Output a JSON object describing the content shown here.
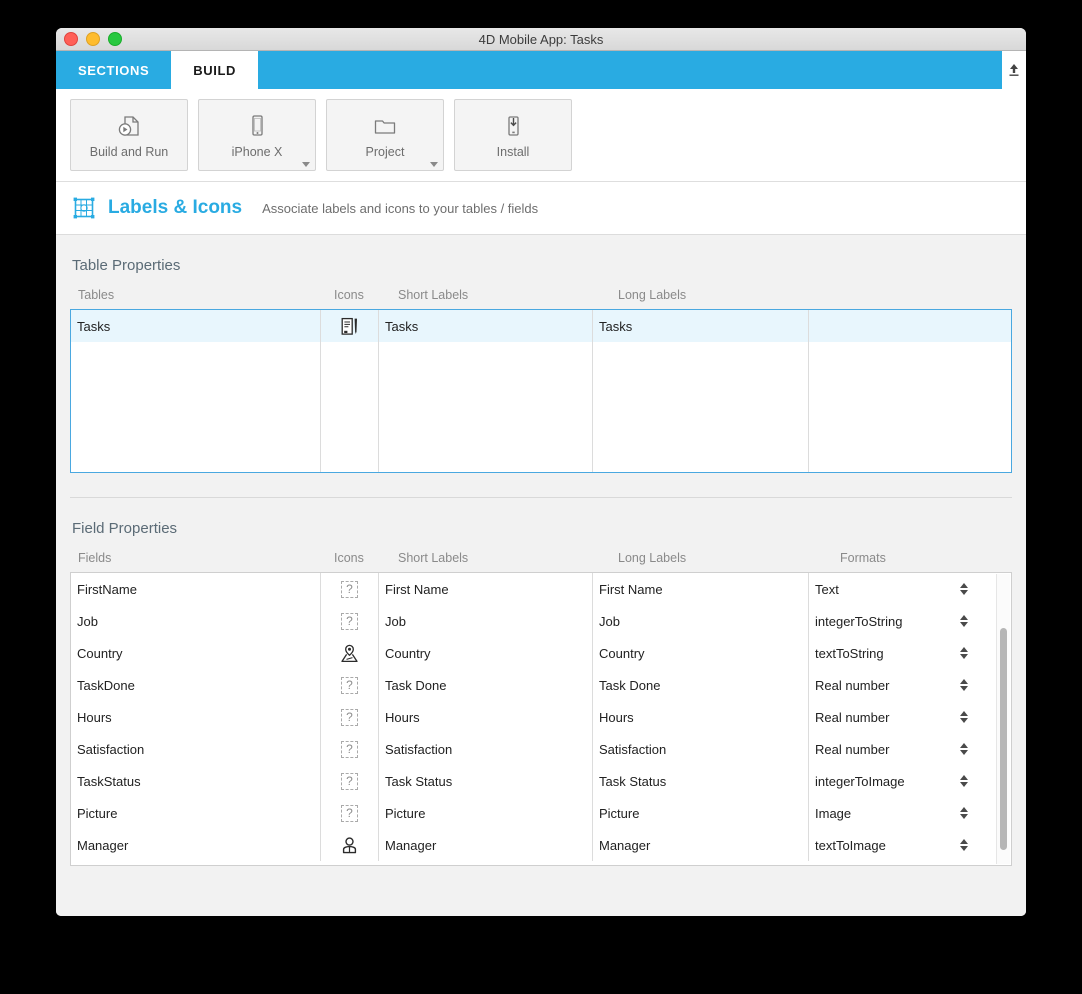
{
  "window": {
    "title": "4D Mobile App: Tasks",
    "controls": [
      "close",
      "minimize",
      "zoom"
    ]
  },
  "tabs": [
    {
      "label": "SECTIONS",
      "active": false
    },
    {
      "label": "BUILD",
      "active": true
    }
  ],
  "tabbar": {
    "upload_icon": "upload-icon"
  },
  "toolbar": {
    "buttons": [
      {
        "label": "Build and Run",
        "icon": "document-play-icon",
        "has_dropdown": false
      },
      {
        "label": "iPhone X",
        "icon": "phone-icon",
        "has_dropdown": true
      },
      {
        "label": "Project",
        "icon": "folder-icon",
        "has_dropdown": true
      },
      {
        "label": "Install",
        "icon": "device-install-icon",
        "has_dropdown": false
      }
    ]
  },
  "section": {
    "icon": "labels-grid-icon",
    "title": "Labels & Icons",
    "subtitle": "Associate labels and icons to your tables / fields",
    "accent_color": "#29abe2"
  },
  "table_properties": {
    "panel_title": "Table Properties",
    "columns": [
      "Tables",
      "Icons",
      "Short Labels",
      "Long Labels",
      ""
    ],
    "rows": [
      {
        "name": "Tasks",
        "icon": "notepad-pen-icon",
        "short_label": "Tasks",
        "long_label": "Tasks",
        "extra": "",
        "selected": true
      }
    ],
    "empty_rows": 4
  },
  "field_properties": {
    "panel_title": "Field Properties",
    "columns": [
      "Fields",
      "Icons",
      "Short Labels",
      "Long Labels",
      "Formats"
    ],
    "rows": [
      {
        "name": "FirstName",
        "icon": "question-placeholder-icon",
        "short_label": "First Name",
        "long_label": "First Name",
        "format": "Text"
      },
      {
        "name": "Job",
        "icon": "question-placeholder-icon",
        "short_label": "Job",
        "long_label": "Job",
        "format": "integerToString"
      },
      {
        "name": "Country",
        "icon": "map-pin-icon",
        "short_label": "Country",
        "long_label": "Country",
        "format": "textToString"
      },
      {
        "name": "TaskDone",
        "icon": "question-placeholder-icon",
        "short_label": "Task Done",
        "long_label": "Task Done",
        "format": "Real number"
      },
      {
        "name": "Hours",
        "icon": "question-placeholder-icon",
        "short_label": "Hours",
        "long_label": "Hours",
        "format": "Real number"
      },
      {
        "name": "Satisfaction",
        "icon": "question-placeholder-icon",
        "short_label": "Satisfaction",
        "long_label": "Satisfaction",
        "format": "Real number"
      },
      {
        "name": "TaskStatus",
        "icon": "question-placeholder-icon",
        "short_label": "Task Status",
        "long_label": "Task Status",
        "format": "integerToImage"
      },
      {
        "name": "Picture",
        "icon": "question-placeholder-icon",
        "short_label": "Picture",
        "long_label": "Picture",
        "format": "Image"
      },
      {
        "name": "Manager",
        "icon": "person-icon",
        "short_label": "Manager",
        "long_label": "Manager",
        "format": "textToImage"
      }
    ],
    "scrollbar": {
      "visible": true
    }
  },
  "colors": {
    "accent": "#29abe2",
    "selection_row": "#e8f6fd",
    "body_background": "#f2f2f2"
  }
}
